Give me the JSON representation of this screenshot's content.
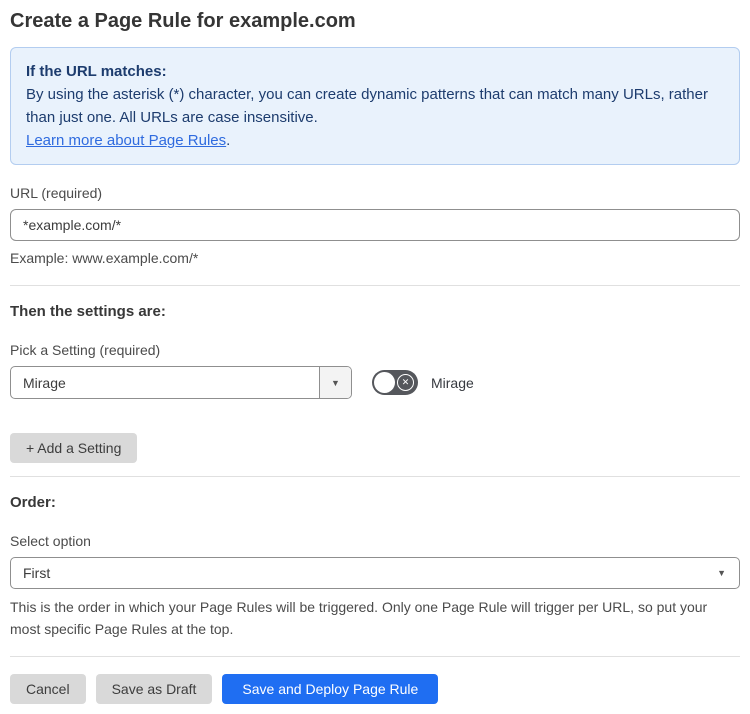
{
  "page": {
    "title": "Create a Page Rule for example.com"
  },
  "info_box": {
    "heading": "If the URL matches:",
    "body": "By using the asterisk (*) character, you can create dynamic patterns that can match many URLs, rather than just one. All URLs are case insensitive.",
    "link_label": "Learn more about Page Rules",
    "link_suffix": "."
  },
  "url_field": {
    "label": "URL (required)",
    "value": "*example.com/*",
    "helper": "Example: www.example.com/*"
  },
  "settings_section": {
    "heading": "Then the settings are:",
    "picker_label": "Pick a Setting (required)",
    "selected_setting": "Mirage",
    "toggle_label": "Mirage",
    "toggle_state": "off",
    "add_setting_label": "+ Add a Setting"
  },
  "order_section": {
    "heading": "Order:",
    "select_label": "Select option",
    "selected_option": "First",
    "helper": "This is the order in which your Page Rules will be triggered. Only one Page Rule will trigger per URL, so put your most specific Page Rules at the top."
  },
  "footer": {
    "cancel_label": "Cancel",
    "save_draft_label": "Save as Draft",
    "save_deploy_label": "Save and Deploy Page Rule"
  },
  "icons": {
    "dropdown_arrow": "▼",
    "select_arrow": "▼",
    "toggle_x": "✕"
  },
  "colors": {
    "accent_blue": "#1f6ef2",
    "info_bg": "#e9f2fc",
    "info_border": "#b3cdf0",
    "info_text": "#1d3c6e",
    "link_blue": "#2f6bdf",
    "toggle_off_bg": "#55575c",
    "button_gray": "#d9d9d9"
  }
}
